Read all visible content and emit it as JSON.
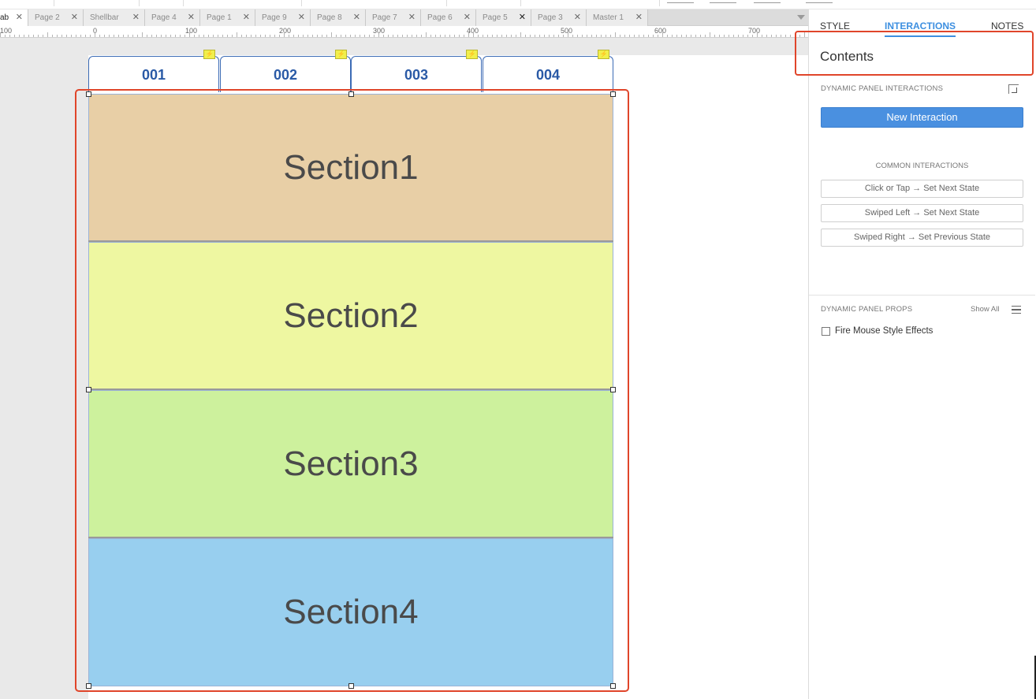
{
  "page_tabs": [
    {
      "label": "ab",
      "active": true
    },
    {
      "label": "Page 2",
      "active": false
    },
    {
      "label": "Shellbar",
      "active": false
    },
    {
      "label": "Page 4",
      "active": false
    },
    {
      "label": "Page 1",
      "active": false
    },
    {
      "label": "Page 9",
      "active": false
    },
    {
      "label": "Page 8",
      "active": false
    },
    {
      "label": "Page 7",
      "active": false
    },
    {
      "label": "Page 6",
      "active": false
    },
    {
      "label": "Page 5",
      "active": false
    },
    {
      "label": "Page 3",
      "active": false
    },
    {
      "label": "Master 1",
      "active": false
    }
  ],
  "ruler": {
    "labels": [
      "100",
      "0",
      "100",
      "200",
      "300",
      "400",
      "500",
      "600",
      "700"
    ]
  },
  "canvas": {
    "tabs": [
      "001",
      "002",
      "003",
      "004"
    ],
    "sections": [
      {
        "label": "Section1",
        "color": "#e8cfa6"
      },
      {
        "label": "Section2",
        "color": "#eef7a1"
      },
      {
        "label": "Section3",
        "color": "#cdf19d"
      },
      {
        "label": "Section4",
        "color": "#98cfef"
      }
    ],
    "highlight_color": "#e0452a"
  },
  "right_panel": {
    "tabs": [
      "STYLE",
      "INTERACTIONS",
      "NOTES"
    ],
    "active_tab": "INTERACTIONS",
    "title": "Contents",
    "section_interactions": "DYNAMIC PANEL INTERACTIONS",
    "new_interaction": "New Interaction",
    "common_title": "COMMON INTERACTIONS",
    "common": [
      "Click or Tap → Set Next State",
      "Swiped Left → Set Next State",
      "Swiped Right → Set Previous State"
    ],
    "props_title": "DYNAMIC PANEL PROPS",
    "show_all": "Show All",
    "fire_mouse": "Fire Mouse Style Effects",
    "accent_color": "#3d8fe0"
  }
}
